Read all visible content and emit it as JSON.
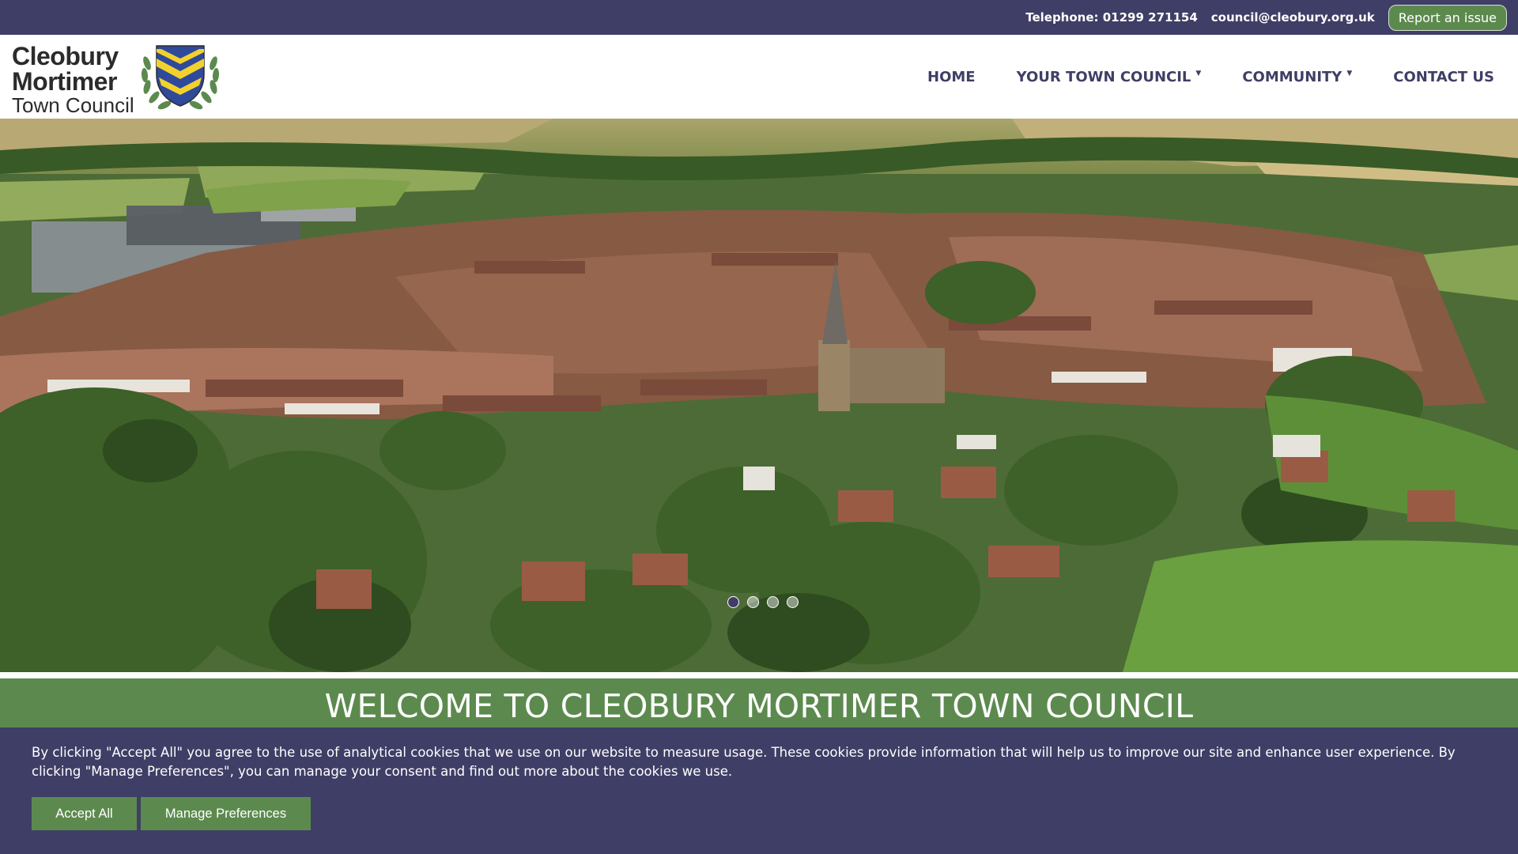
{
  "topbar": {
    "telephone": "Telephone: 01299 271154",
    "email": "council@cleobury.org.uk",
    "report_button": "Report an issue"
  },
  "logo": {
    "line1": "Cleobury",
    "line2": "Mortimer",
    "line3": "Town Council"
  },
  "nav": {
    "items": [
      {
        "label": "HOME",
        "dropdown": false
      },
      {
        "label": "YOUR TOWN COUNCIL",
        "dropdown": true
      },
      {
        "label": "COMMUNITY",
        "dropdown": true
      },
      {
        "label": "CONTACT US",
        "dropdown": false
      }
    ]
  },
  "hero": {
    "slides": 4,
    "active_slide": 1
  },
  "welcome": {
    "heading": "WELCOME TO CLEOBURY MORTIMER TOWN COUNCIL"
  },
  "cookie": {
    "message": "By clicking \"Accept All\" you agree to the use of analytical cookies that we use on our website to measure usage. These cookies provide information that will help us to improve our site and enhance user experience. By clicking \"Manage Preferences\", you can manage your consent and find out more about the cookies we use.",
    "accept_label": "Accept All",
    "manage_label": "Manage Preferences"
  },
  "colors": {
    "primary": "#3f3e66",
    "accent_green": "#5c8a4e",
    "crest_blue": "#2f4a9a",
    "crest_yellow": "#f2d12e"
  },
  "icons": [
    "crest-icon",
    "caret-down-icon"
  ]
}
